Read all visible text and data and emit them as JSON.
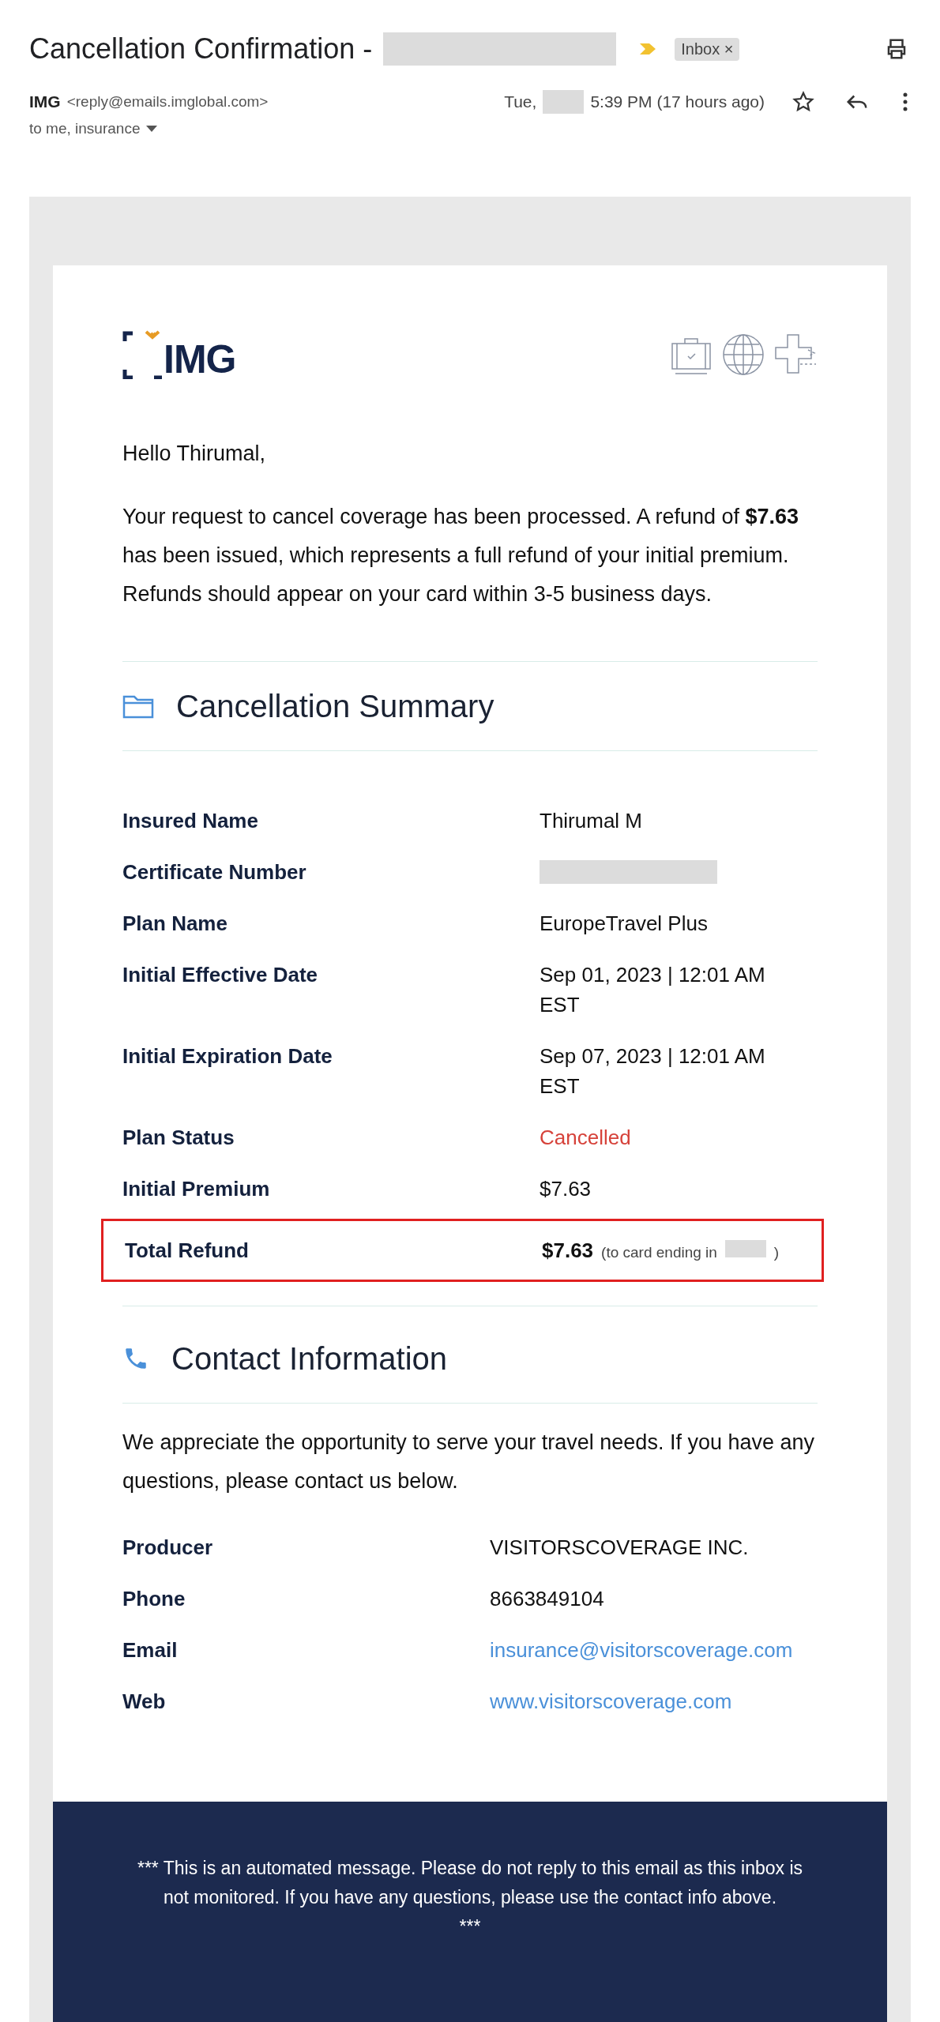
{
  "header": {
    "subject": "Cancellation Confirmation -",
    "subject_redacted": true,
    "label": {
      "text": "Inbox",
      "remove": "×"
    }
  },
  "sender": {
    "name": "IMG",
    "address": "<reply@emails.imglobal.com>",
    "recipients": "to me, insurance",
    "date": "Tue,",
    "date_redacted": true,
    "time": "5:39 PM (17 hours ago)",
    "starred": false
  },
  "email": {
    "logo": {
      "text": "IMG"
    },
    "greeting": "Hello Thirumal,",
    "intro": "Your request to cancel coverage has been processed. A refund of **$7.63** has been issued, which represents a full refund of your initial premium. Refunds should appear on your card within 3-5 business days.",
    "summary": {
      "title": "Cancellation Summary",
      "rows": [
        {
          "kind": "text",
          "label": "Insured Name",
          "value": "Thirumal M"
        },
        {
          "kind": "redacted",
          "label": "Certificate Number"
        },
        {
          "kind": "text",
          "label": "Plan Name",
          "value": "EuropeTravel Plus"
        },
        {
          "kind": "text",
          "label": "Initial Effective Date",
          "value": "Sep 01, 2023 | 12:01 AM EST"
        },
        {
          "kind": "text",
          "label": "Initial Expiration Date",
          "value": "Sep 07, 2023 | 12:01 AM EST"
        },
        {
          "kind": "status",
          "label": "Plan Status",
          "value": "Cancelled"
        },
        {
          "kind": "text",
          "label": "Initial Premium",
          "value": "$7.63"
        },
        {
          "kind": "total",
          "label": "Total Refund",
          "value": "$7.63",
          "note_open": "(to card ending in",
          "note_close": ")"
        }
      ]
    },
    "contact": {
      "title": "Contact Information",
      "text": "We appreciate the opportunity to serve your travel needs. If you have any questions, please contact us below.",
      "rows": [
        {
          "kind": "text",
          "label": "Producer",
          "value": "VISITORSCOVERAGE INC."
        },
        {
          "kind": "text",
          "label": "Phone",
          "value": "8663849104"
        },
        {
          "kind": "link",
          "label": "Email",
          "value": "insurance@visitorscoverage.com"
        },
        {
          "kind": "link",
          "label": "Web",
          "value": "www.visitorscoverage.com"
        }
      ]
    },
    "footer": {
      "text": "*** This is an automated message. Please do not reply to this email as this inbox is not monitored. If you have any questions, please use the contact info above.",
      "end": "***"
    }
  }
}
